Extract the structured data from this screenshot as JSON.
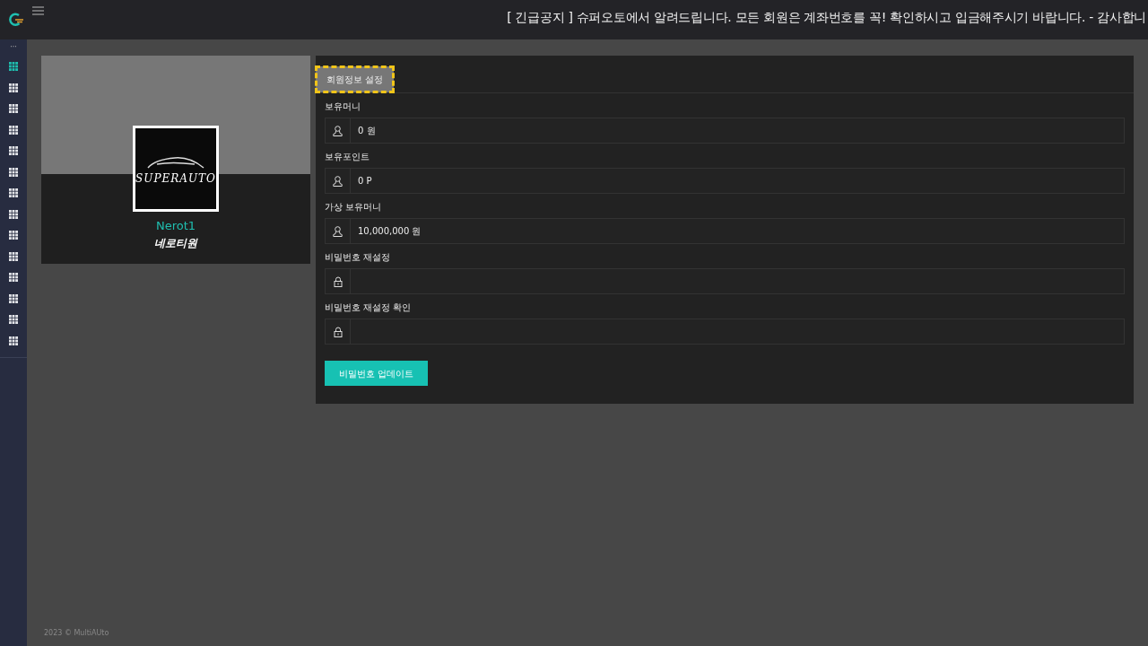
{
  "topbar": {
    "notice": "[ 긴급공지 ] 슈퍼오토에서 알려드립니다. 모든 회원은 계좌번호를 꼭! 확인하시고 입금해주시기 바랍니다. - 감사합니"
  },
  "sidebar": {
    "more": "···",
    "items": [
      {
        "selected": true
      },
      {
        "selected": false
      },
      {
        "selected": false
      },
      {
        "selected": false
      },
      {
        "selected": false
      },
      {
        "selected": false
      },
      {
        "selected": false
      },
      {
        "selected": false
      },
      {
        "selected": false
      },
      {
        "selected": false
      },
      {
        "selected": false
      },
      {
        "selected": false
      },
      {
        "selected": false
      },
      {
        "selected": false
      }
    ]
  },
  "profile": {
    "logo_text": "SUPERAUTO",
    "username": "Nerot1",
    "nickname": "네로티원"
  },
  "tabs": [
    {
      "label": "회원정보 설정",
      "selected": true
    }
  ],
  "fields": [
    {
      "label": "보유머니",
      "kind": "account",
      "value": "0 원"
    },
    {
      "label": "보유포인트",
      "kind": "account",
      "value": "0 P"
    },
    {
      "label": "가상 보유머니",
      "kind": "account",
      "value": "10,000,000 원"
    },
    {
      "label": "비밀번호 재설정",
      "kind": "password"
    },
    {
      "label": "비밀번호 재설정 확인",
      "kind": "password"
    }
  ],
  "submit_button": "비밀번호 업데이트",
  "footer": "2023 © MultiAUto"
}
